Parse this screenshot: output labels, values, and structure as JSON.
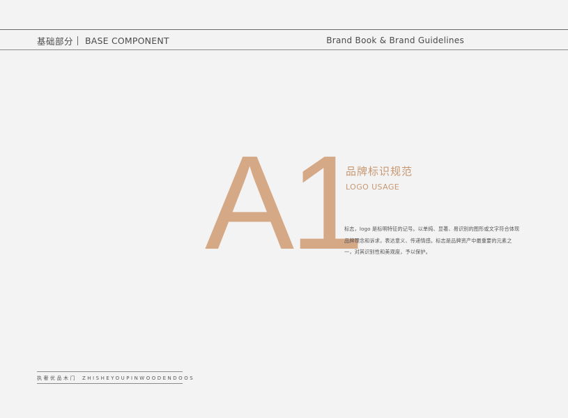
{
  "header": {
    "section_cn": "基础部分",
    "section_en": "BASE COMPONENT",
    "book_title": "Brand Book & Brand Guidelines"
  },
  "hero": {
    "number": "A1"
  },
  "section": {
    "title_cn": "品牌标识规范",
    "title_en": "LOGO USAGE",
    "body_lines": [
      "标志，logo 是标明特征的记号。以单纯、显著、易识别的图形或文字符合体现",
      "品牌理念和诉求，表达意义、传递情感。标志是品牌资产中最重要的元素之",
      "一，对其识别性和美观度，予以保护。"
    ]
  },
  "footer": {
    "brand_cn": "执奢优品木门",
    "brand_en": "ZHISHEYOUPINWOODENDOOS"
  },
  "colors": {
    "accent": "#d5a886",
    "accent_text": "#c79772",
    "background": "#f4f3f3",
    "text": "#4a4a4a"
  }
}
